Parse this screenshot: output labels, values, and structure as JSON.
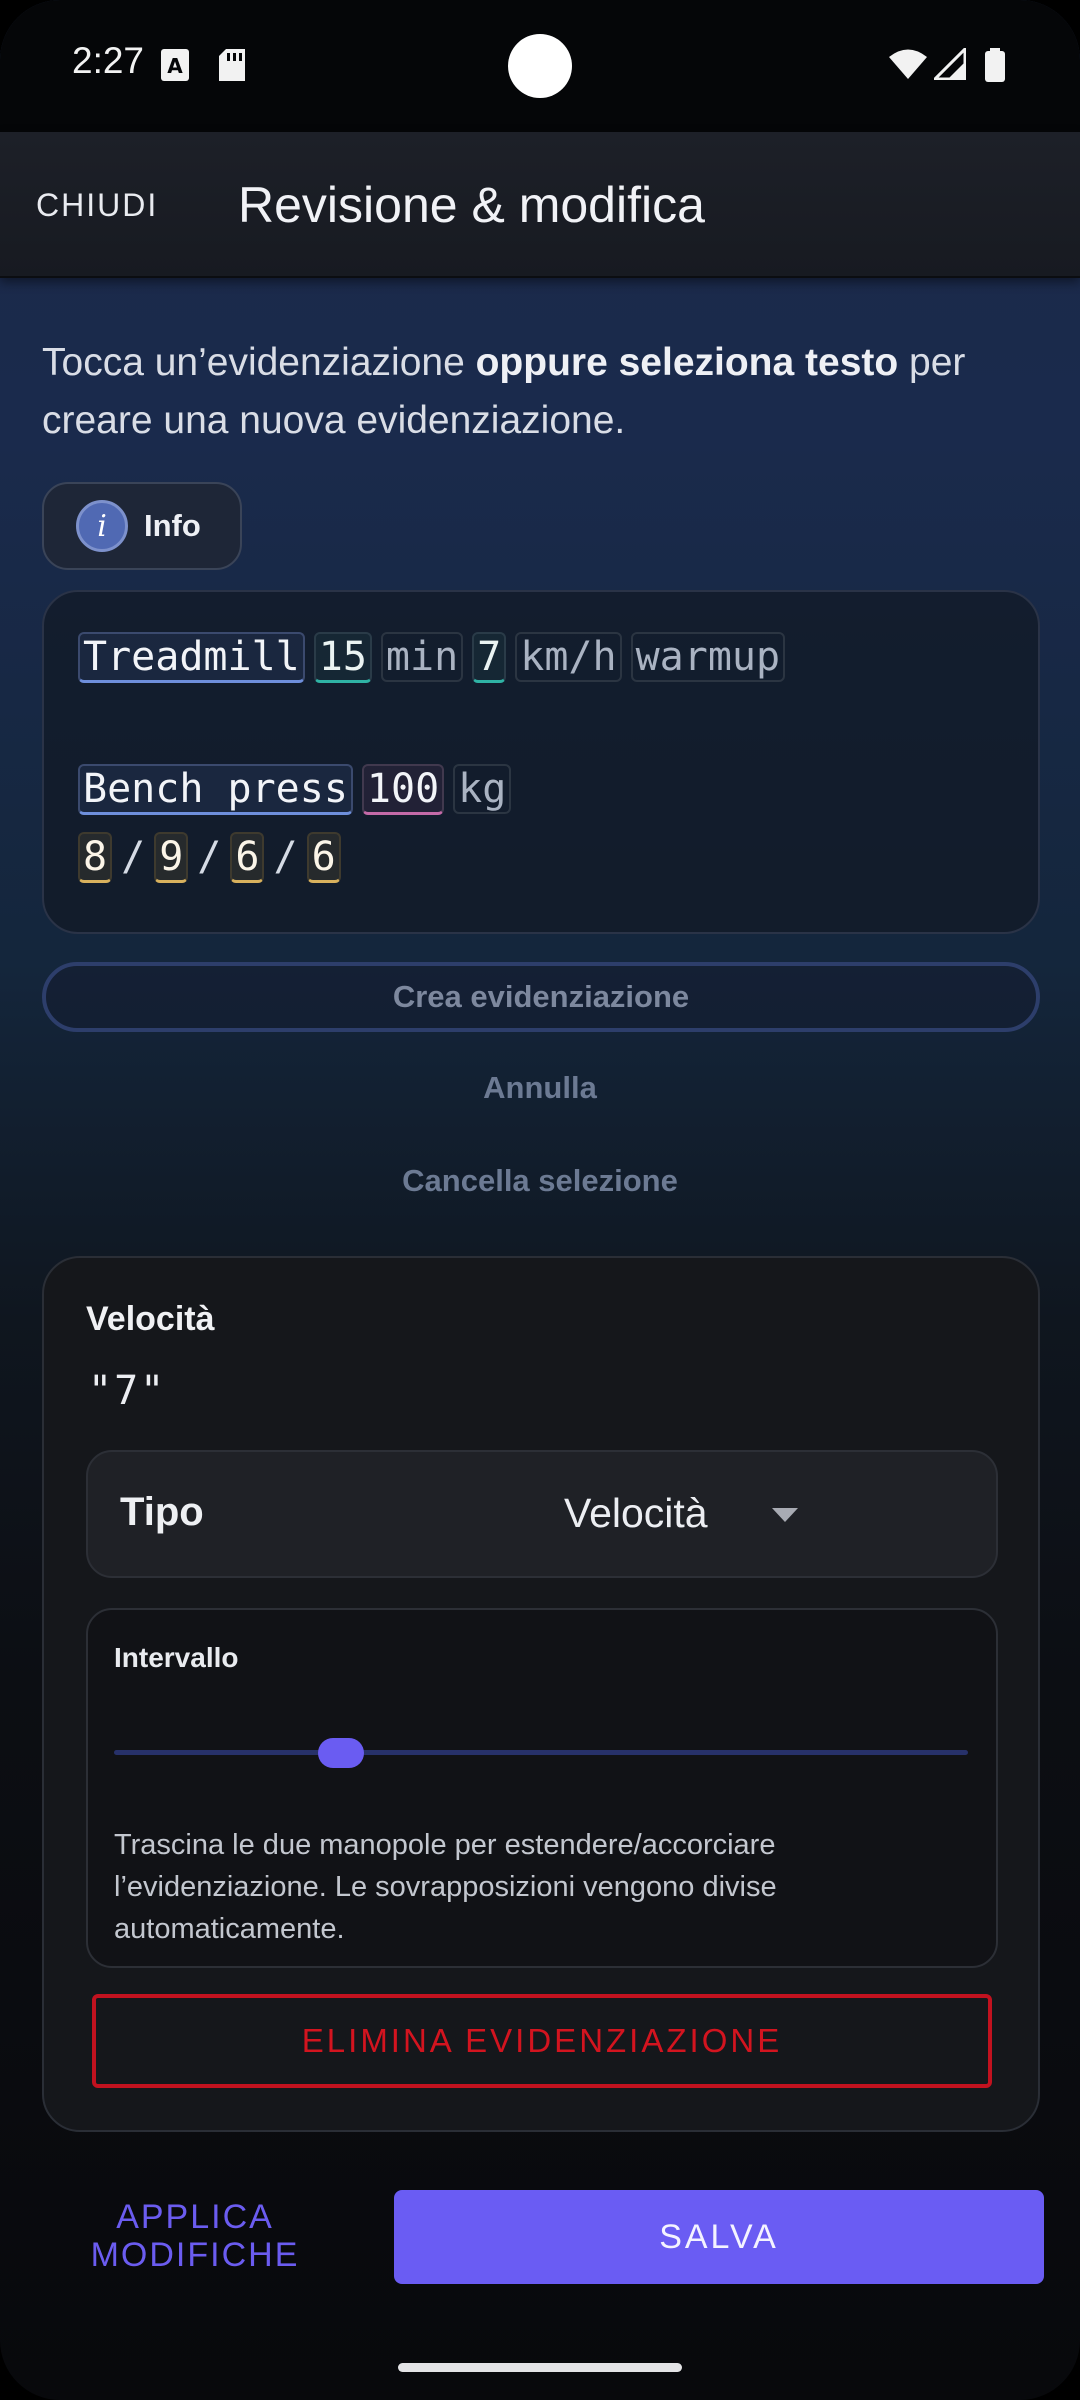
{
  "status_bar": {
    "time": "2:27",
    "icons": [
      "text-notification-icon",
      "sd-card-icon",
      "wifi-icon",
      "signal-icon",
      "battery-icon"
    ]
  },
  "app_bar": {
    "close_label": "CHIUDI",
    "title": "Revisione & modifica"
  },
  "instructions": {
    "part1": "Tocca un’evidenziazione ",
    "bold": "oppure seleziona testo",
    "part2": " per creare una nuova evidenziazione."
  },
  "info_chip": {
    "icon": "i",
    "label": "Info"
  },
  "workout_text": {
    "line1": [
      {
        "text": "Treadmill",
        "kind": "ex"
      },
      {
        "text": "15",
        "kind": "num"
      },
      {
        "text": "min",
        "kind": "unit"
      },
      {
        "text": "7",
        "kind": "num"
      },
      {
        "text": "km/h",
        "kind": "unit"
      },
      {
        "text": "warmup",
        "kind": "warm"
      }
    ],
    "line3": [
      {
        "text": "Bench press",
        "kind": "ex"
      },
      {
        "text": "100",
        "kind": "wt"
      },
      {
        "text": "kg",
        "kind": "unit"
      }
    ],
    "line4": [
      {
        "text": "8",
        "kind": "rep"
      },
      {
        "text": "/",
        "kind": "sep"
      },
      {
        "text": "9",
        "kind": "rep"
      },
      {
        "text": "/",
        "kind": "sep"
      },
      {
        "text": "6",
        "kind": "rep"
      },
      {
        "text": "/",
        "kind": "sep"
      },
      {
        "text": "6",
        "kind": "rep"
      }
    ]
  },
  "actions": {
    "create": "Crea evidenziazione",
    "cancel": "Annulla",
    "clear_selection": "Cancella selezione"
  },
  "detail": {
    "field_title": "Velocità",
    "field_value": "\"7\"",
    "type_label": "Tipo",
    "type_value": "Velocità",
    "range_title": "Intervallo",
    "range_help": "Trascina le due manopole per estendere/accorciare l’evidenziazione. Le sovrapposizioni vengono divise automaticamente.",
    "delete_label": "ELIMINA EVIDENZIAZIONE"
  },
  "bottom": {
    "apply_label": "APPLICA MODIFICHE",
    "save_label": "SALVA"
  },
  "colors": {
    "accent": "#6a5cf3",
    "danger": "#d3141f",
    "highlight_exercise": "#6e8fdc",
    "highlight_number": "#2fb3a5",
    "highlight_weight": "#c46aa8",
    "highlight_reps": "#d8b15d"
  }
}
